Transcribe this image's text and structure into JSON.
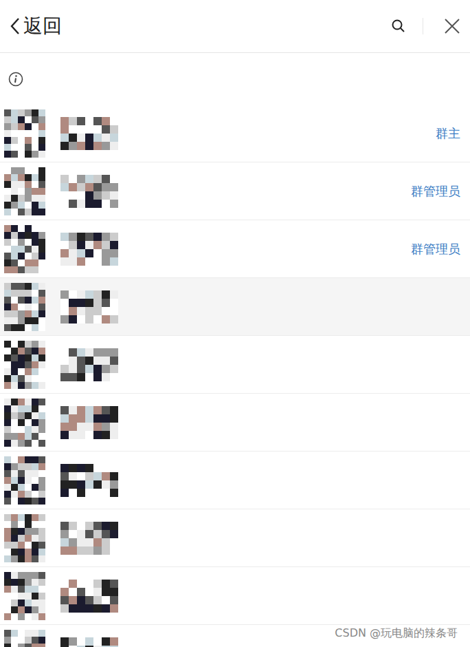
{
  "header": {
    "back": "返回"
  },
  "members": [
    {
      "role": "群主",
      "selected": false
    },
    {
      "role": "群管理员",
      "selected": false
    },
    {
      "role": "群管理员",
      "selected": false
    },
    {
      "role": "",
      "selected": true
    },
    {
      "role": "",
      "selected": false
    },
    {
      "role": "",
      "selected": false
    },
    {
      "role": "",
      "selected": false
    },
    {
      "role": "",
      "selected": false
    },
    {
      "role": "",
      "selected": false
    },
    {
      "role": "",
      "selected": false
    }
  ],
  "watermark": "CSDN @玩电脑的辣条哥"
}
